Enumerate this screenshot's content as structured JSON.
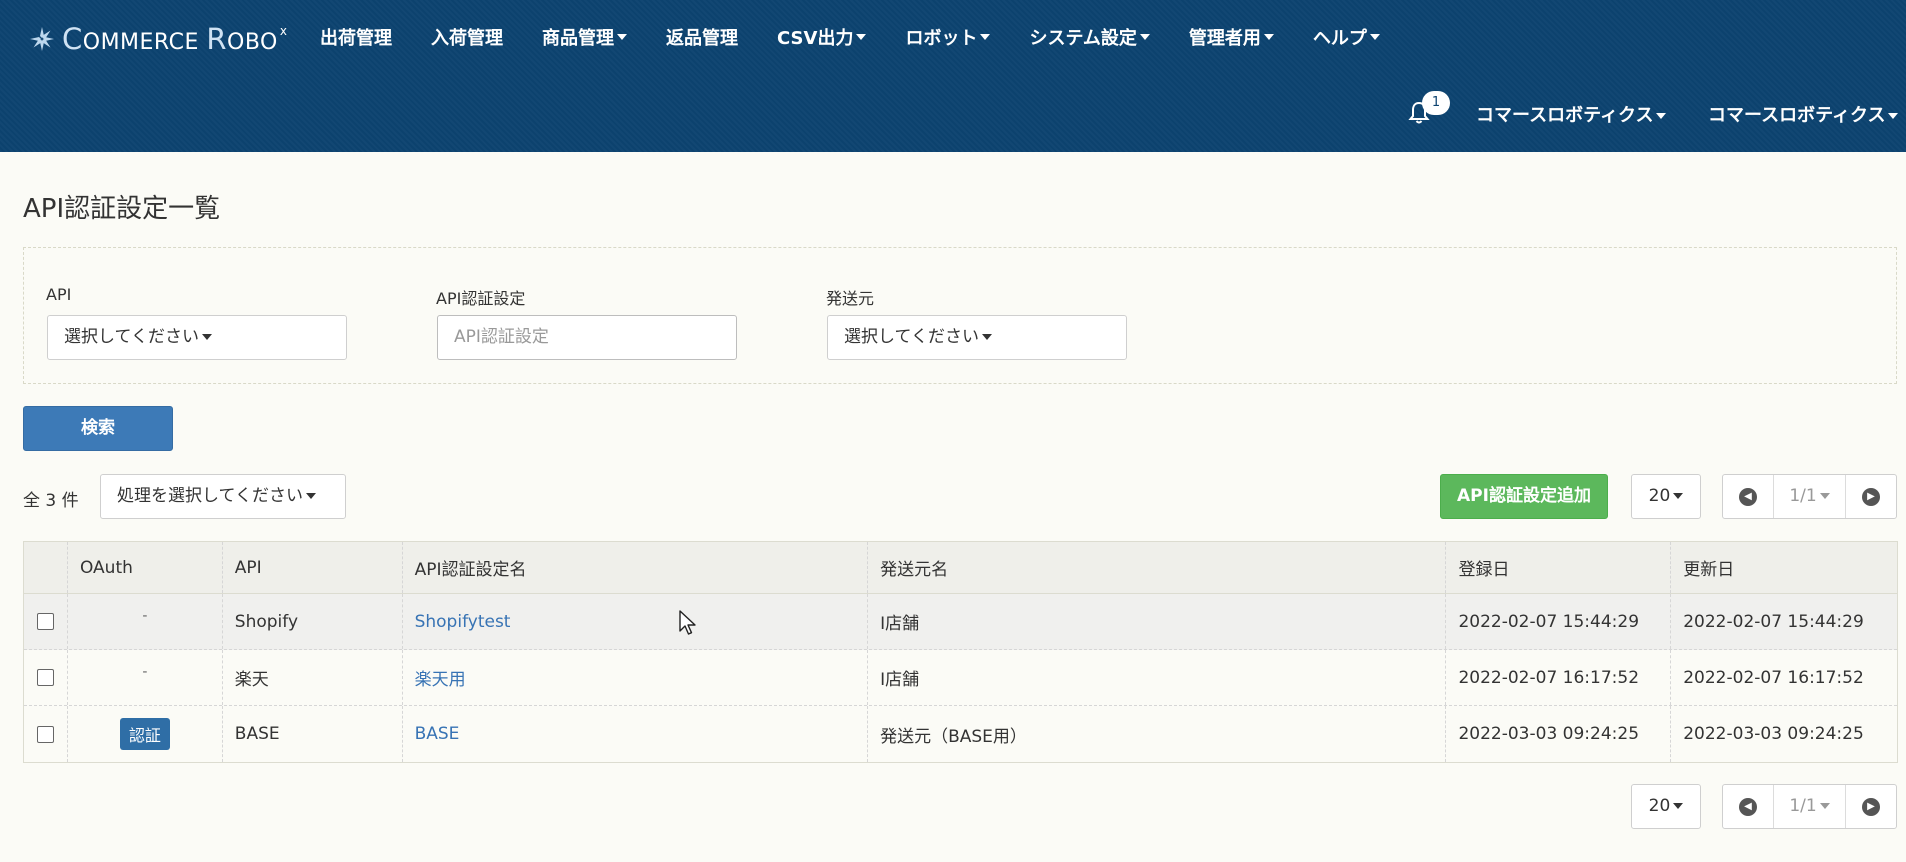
{
  "app": {
    "brand": "COMMERCE ROBO",
    "brand_sup": "x"
  },
  "nav": {
    "items": [
      "出荷管理",
      "入荷管理",
      "商品管理",
      "返品管理",
      "CSV出力",
      "ロボット",
      "システム設定",
      "管理者用",
      "ヘルプ"
    ],
    "dropdown": [
      false,
      false,
      true,
      false,
      true,
      true,
      true,
      true,
      true
    ],
    "notification_count": "1",
    "user_menu_1": "コマースロボティクス",
    "user_menu_2": "コマースロボティクス"
  },
  "page": {
    "title": "API認証設定一覧"
  },
  "filters": {
    "api_label": "API",
    "api_value": "選択してください",
    "auth_label": "API認証設定",
    "auth_placeholder": "API認証設定",
    "sender_label": "発送元",
    "sender_value": "選択してください",
    "search_button": "検索"
  },
  "toolbar": {
    "count": "全 3 件",
    "action_select": "処理を選択してください",
    "add_button": "API認証設定追加",
    "per_page": "20",
    "page": "1/1"
  },
  "table": {
    "headers": [
      "OAuth",
      "API",
      "API認証設定名",
      "発送元名",
      "登録日",
      "更新日"
    ],
    "rows": [
      {
        "oauth": "-",
        "oauth_button": false,
        "api": "Shopify",
        "name": "Shopifytest",
        "sender": "I店舗",
        "created": "2022-02-07 15:44:29",
        "updated": "2022-02-07 15:44:29"
      },
      {
        "oauth": "-",
        "oauth_button": false,
        "api": "楽天",
        "name": "楽天用",
        "sender": "I店舗",
        "created": "2022-02-07 16:17:52",
        "updated": "2022-02-07 16:17:52"
      },
      {
        "oauth": "認証",
        "oauth_button": true,
        "api": "BASE",
        "name": "BASE",
        "sender": "発送元（BASE用）",
        "created": "2022-03-03 09:24:25",
        "updated": "2022-03-03 09:24:25"
      }
    ]
  },
  "bottom": {
    "per_page": "20",
    "page": "1/1"
  },
  "colors": {
    "navbar": "#0c4370",
    "primary": "#3d7ab7",
    "success": "#5cb85c",
    "link": "#3773b4"
  }
}
